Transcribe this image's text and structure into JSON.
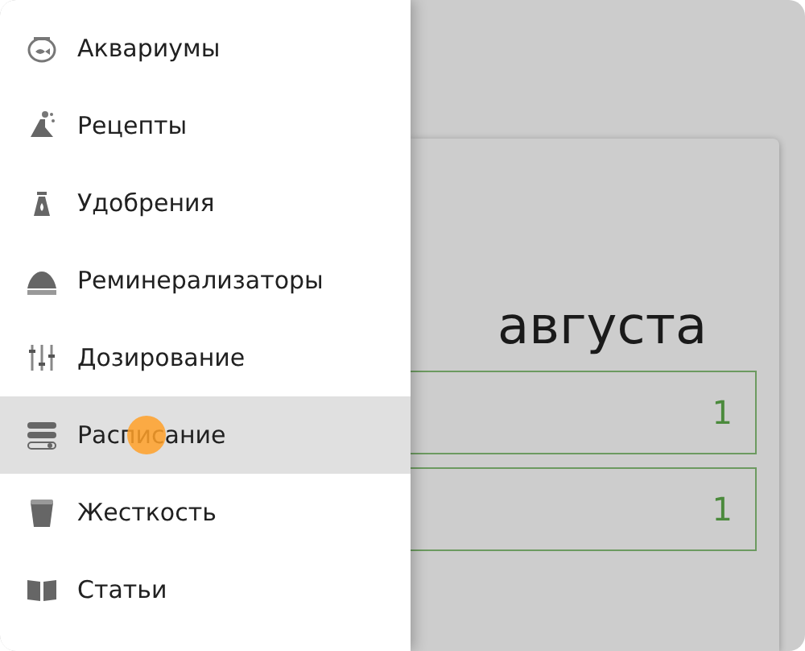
{
  "drawer": {
    "items": [
      {
        "label": "Аквариумы",
        "selected": false
      },
      {
        "label": "Рецепты",
        "selected": false
      },
      {
        "label": "Удобрения",
        "selected": false
      },
      {
        "label": "Реминерализаторы",
        "selected": false
      },
      {
        "label": "Дозирование",
        "selected": false
      },
      {
        "label": "Расписание",
        "selected": true
      },
      {
        "label": "Жесткость",
        "selected": false
      },
      {
        "label": "Статьи",
        "selected": false
      }
    ]
  },
  "card": {
    "title": "августа",
    "fields": [
      {
        "value": "1"
      },
      {
        "value": "1"
      }
    ]
  }
}
